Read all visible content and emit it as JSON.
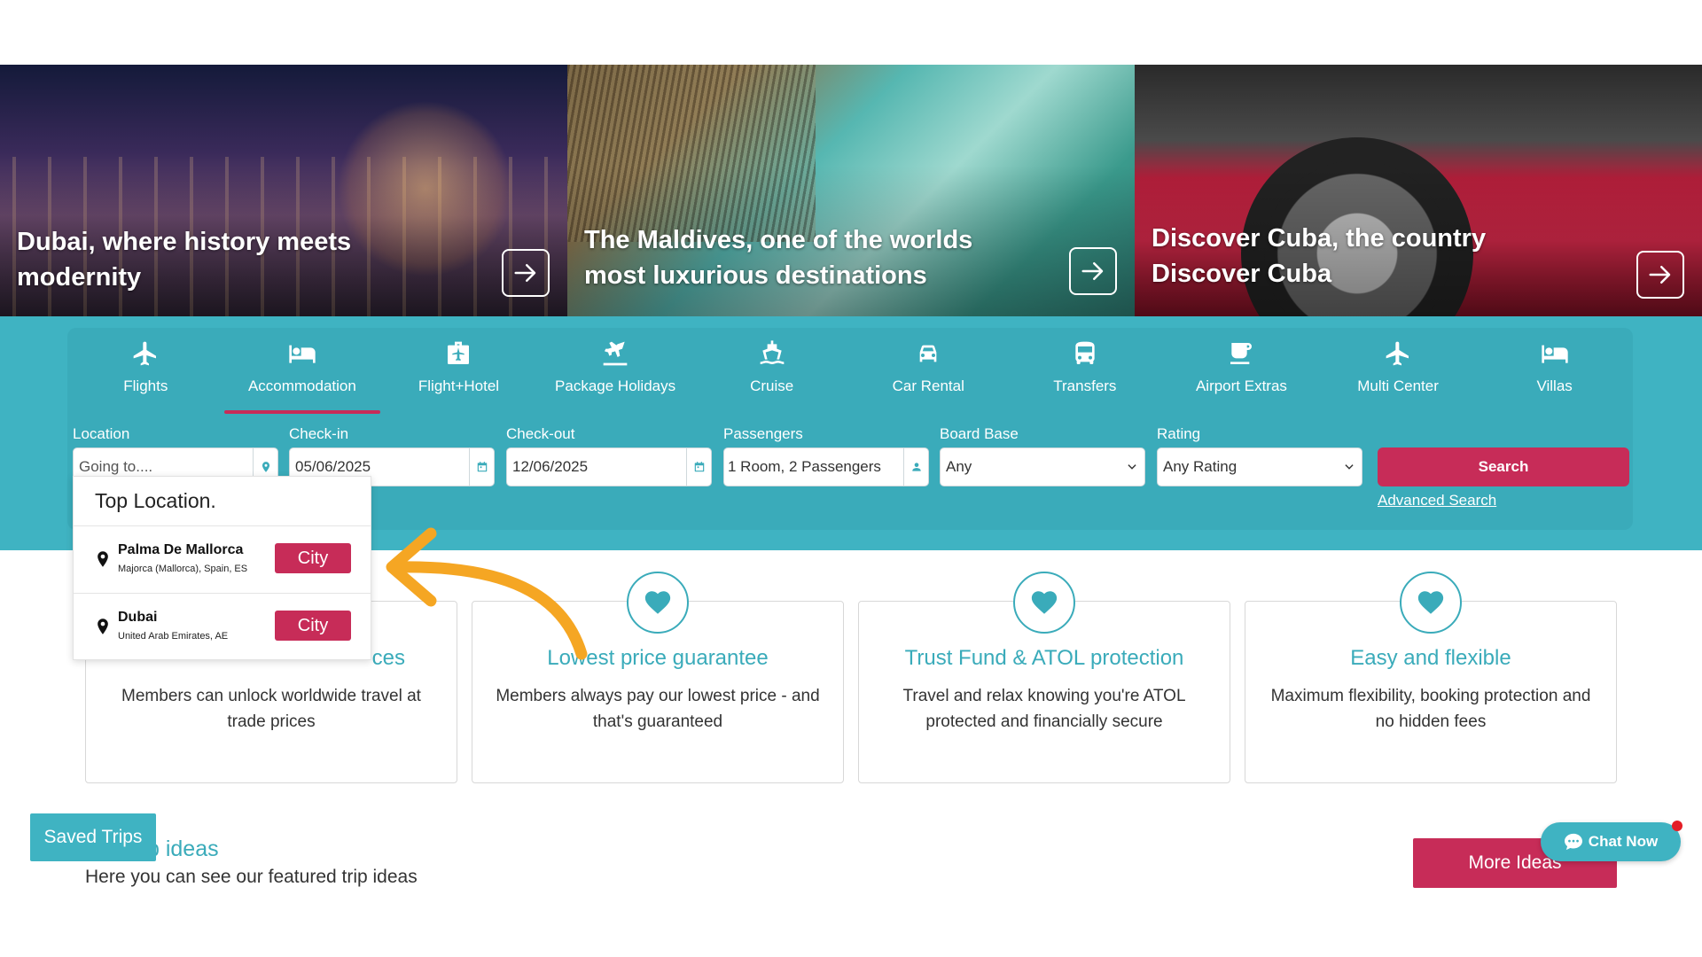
{
  "hero": [
    {
      "title": "Dubai, where history meets modernity"
    },
    {
      "title": "The Maldives, one of the worlds most luxurious destinations"
    },
    {
      "title": "Discover Cuba, the country Discover Cuba"
    }
  ],
  "tabs": [
    {
      "label": "Flights",
      "icon": "plane-icon"
    },
    {
      "label": "Accommodation",
      "icon": "bed-icon",
      "active": true
    },
    {
      "label": "Flight+Hotel",
      "icon": "suitcase-icon"
    },
    {
      "label": "Package Holidays",
      "icon": "beach-plane-icon"
    },
    {
      "label": "Cruise",
      "icon": "ship-icon"
    },
    {
      "label": "Car Rental",
      "icon": "car-icon"
    },
    {
      "label": "Transfers",
      "icon": "bus-icon"
    },
    {
      "label": "Airport Extras",
      "icon": "coffee-icon"
    },
    {
      "label": "Multi Center",
      "icon": "plane-icon"
    },
    {
      "label": "Villas",
      "icon": "bed-icon"
    }
  ],
  "search": {
    "location_label": "Location",
    "location_placeholder": "Going to....",
    "checkin_label": "Check-in",
    "checkin_value": "05/06/2025",
    "checkout_label": "Check-out",
    "checkout_value": "12/06/2025",
    "passengers_label": "Passengers",
    "passengers_value": "1 Room, 2 Passengers",
    "board_label": "Board Base",
    "board_value": "Any",
    "rating_label": "Rating",
    "rating_value": "Any Rating",
    "search_button": "Search",
    "advanced_link": "Advanced Search"
  },
  "dropdown": {
    "heading": "Top Location.",
    "items": [
      {
        "name": "Palma De Mallorca",
        "sub": "Majorca (Mallorca), Spain, ES",
        "badge": "City"
      },
      {
        "name": "Dubai",
        "sub": "United Arab Emirates, AE",
        "badge": "City"
      }
    ]
  },
  "features": [
    {
      "title": "Exclusive trade prices",
      "title_visible": "ces",
      "text": "Members can unlock worldwide travel at trade prices"
    },
    {
      "title": "Lowest price guarantee",
      "text": "Members always pay our lowest price - and that's guaranteed"
    },
    {
      "title": "Trust Fund & ATOL protection",
      "text": "Travel and relax knowing you're ATOL protected and financially secure"
    },
    {
      "title": "Easy and flexible",
      "text": "Maximum flexibility, booking protection and no hidden fees"
    }
  ],
  "trips": {
    "heading_visible": "p ideas",
    "subtitle": "Here you can see our featured trip ideas",
    "more_button": "More Ideas"
  },
  "saved_trips": "Saved Trips",
  "chat": "Chat Now",
  "colors": {
    "accent": "#3fb3c2",
    "brand": "#c72c58",
    "annotation_arrow": "#f5a623"
  }
}
